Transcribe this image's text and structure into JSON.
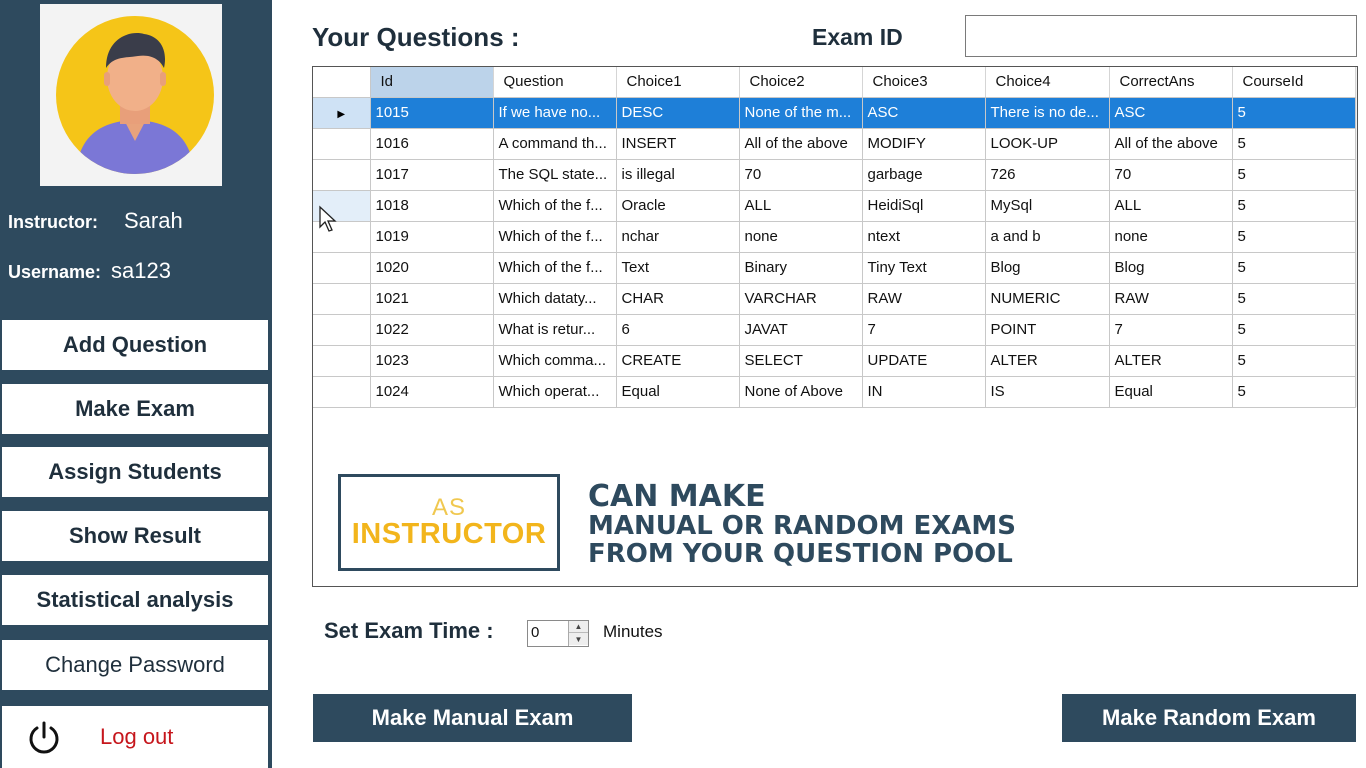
{
  "sidebar": {
    "instructor_label": "Instructor:",
    "instructor_name": "Sarah",
    "username_label": "Username:",
    "username_value": "sa123",
    "buttons": [
      "Add Question",
      "Make Exam",
      "Assign Students",
      "Show Result",
      "Statistical analysis",
      "Change Password"
    ],
    "logout_label": "Log out"
  },
  "main": {
    "title": "Your Questions :",
    "exam_id_label": "Exam ID",
    "exam_id_value": "",
    "grid": {
      "columns": [
        "Id",
        "Question",
        "Choice1",
        "Choice2",
        "Choice3",
        "Choice4",
        "CorrectAns",
        "CourseId"
      ],
      "rows": [
        [
          "1015",
          "If we have no...",
          "DESC",
          "None of the m...",
          "ASC",
          "There is no de...",
          "ASC",
          "5"
        ],
        [
          "1016",
          "A command th...",
          "INSERT",
          "All of the above",
          "MODIFY",
          "LOOK-UP",
          "All of the above",
          "5"
        ],
        [
          "1017",
          "The SQL state...",
          "is illegal",
          "70",
          "garbage",
          "726",
          "70",
          "5"
        ],
        [
          "1018",
          "Which of the f...",
          "Oracle",
          "ALL",
          "HeidiSql",
          "MySql",
          "ALL",
          "5"
        ],
        [
          "1019",
          "Which of the f...",
          "nchar",
          "none",
          "ntext",
          "a and b",
          "none",
          "5"
        ],
        [
          "1020",
          "Which of the f...",
          "Text",
          "Binary",
          "Tiny Text",
          "Blog",
          "Blog",
          "5"
        ],
        [
          "1021",
          " Which dataty...",
          "CHAR",
          "VARCHAR",
          "RAW",
          "NUMERIC",
          "RAW",
          "5"
        ],
        [
          "1022",
          "What is retur...",
          "6",
          "JAVAT",
          "7",
          "POINT",
          "7",
          "5"
        ],
        [
          "1023",
          "Which comma...",
          "CREATE",
          "SELECT",
          "UPDATE",
          "ALTER",
          "ALTER",
          "5"
        ],
        [
          "1024",
          "Which operat...",
          "Equal",
          "None of Above",
          "IN",
          "IS",
          "Equal",
          "5"
        ]
      ],
      "selected_row": 0
    },
    "banner": {
      "as": "AS",
      "role": "INSTRUCTOR",
      "line1": "CAN MAKE",
      "line2": "MANUAL OR RANDOM EXAMS",
      "line3": "FROM YOUR QUESTION POOL"
    },
    "exam_time_label": "Set Exam Time :",
    "exam_time_value": "0",
    "minutes_label": "Minutes",
    "manual_button": "Make Manual Exam",
    "random_button": "Make Random Exam"
  },
  "colors": {
    "sidebar_bg": "#2e4a5e",
    "selection": "#1e7fd8",
    "logout_text": "#c6161c",
    "banner_accent": "#f2b51c"
  }
}
